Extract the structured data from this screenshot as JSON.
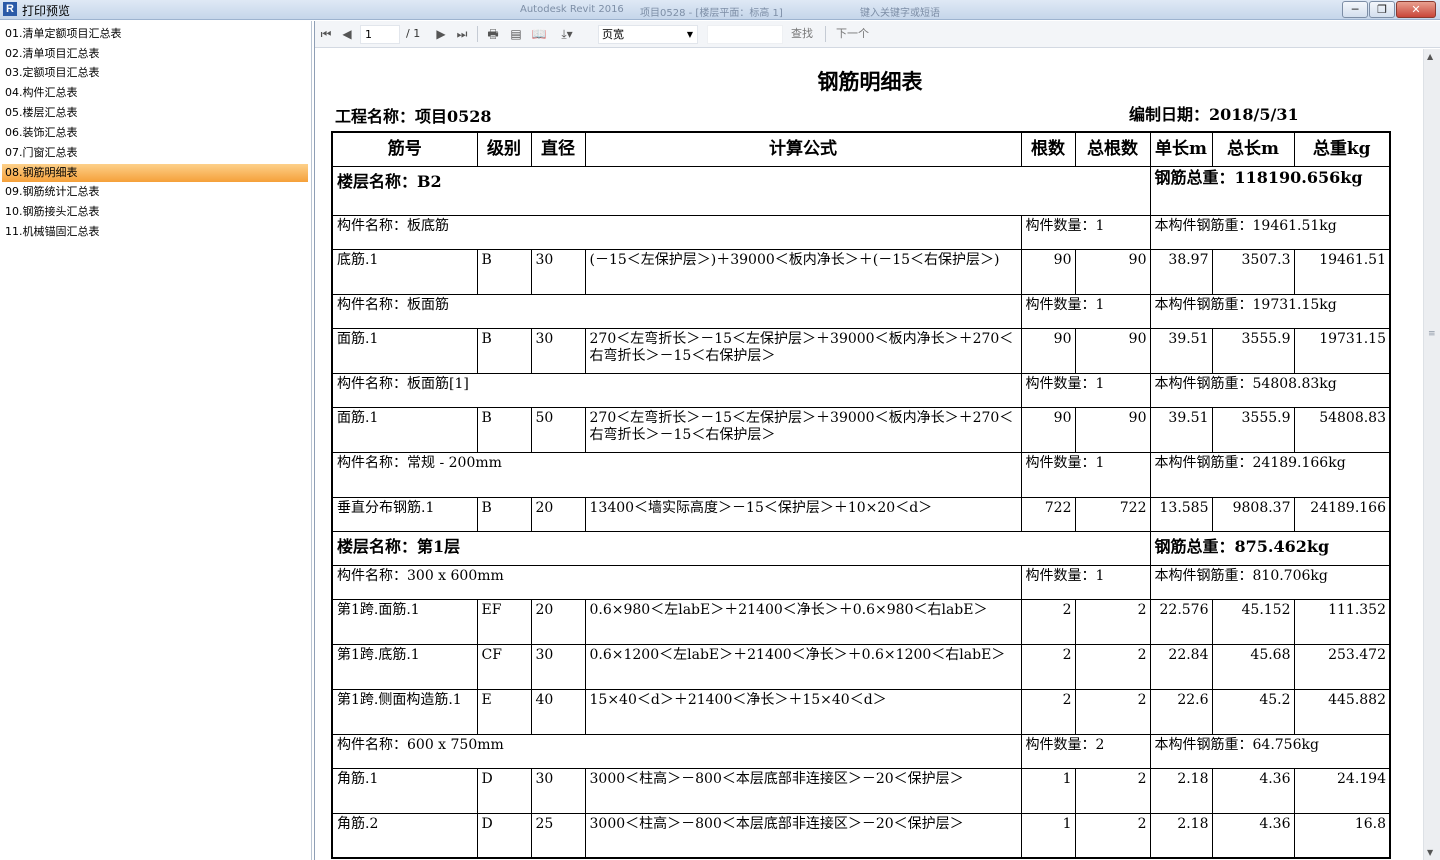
{
  "window": {
    "title": "打印预览",
    "faint_app": "Autodesk Revit 2016",
    "faint_doc": "项目0528 - [楼层平面：标高 1]",
    "faint_search": "键入关键字或短语",
    "buttons": {
      "minimize": "─",
      "restore": "❐",
      "close": "✕"
    }
  },
  "sidebar": {
    "items": [
      {
        "label": "01.清单定额项目汇总表"
      },
      {
        "label": "02.清单项目汇总表"
      },
      {
        "label": "03.定额项目汇总表"
      },
      {
        "label": "04.构件汇总表"
      },
      {
        "label": "05.楼层汇总表"
      },
      {
        "label": "06.装饰汇总表"
      },
      {
        "label": "07.门窗汇总表"
      },
      {
        "label": "08.钢筋明细表"
      },
      {
        "label": "09.钢筋统计汇总表"
      },
      {
        "label": "10.钢筋接头汇总表"
      },
      {
        "label": "11.机械锚固汇总表"
      }
    ],
    "active_index": 7
  },
  "toolbar": {
    "page_current": "1",
    "page_total": "/ 1",
    "zoom_value": "页宽",
    "find_label": "查找",
    "next_label": "下一个",
    "icons": [
      "first-page-icon",
      "prev-page-icon",
      "next-page-icon",
      "last-page-icon",
      "print-icon",
      "page-setup-icon",
      "book-icon",
      "export-icon"
    ]
  },
  "report": {
    "title": "钢筋明细表",
    "project": "工程名称：项目0528",
    "date": "编制日期：2018/5/31",
    "headers": [
      "筋号",
      "级别",
      "直径",
      "计算公式",
      "根数",
      "总根数",
      "单长m",
      "总长m",
      "总重kg"
    ],
    "rows": [
      {
        "kind": "floor",
        "name": "楼层名称：B2",
        "weight": "钢筋总重：118190.656kg"
      },
      {
        "kind": "comp",
        "name": "构件名称：板底筋",
        "count": "构件数量：1",
        "weight": "本构件钢筋重：19461.51kg"
      },
      {
        "kind": "bar",
        "cells": [
          "底筋.1",
          "B",
          "30",
          "(－15＜左保护层＞)＋39000＜板内净长＞＋(－15＜右保护层＞)",
          "90",
          "90",
          "38.97",
          "3507.3",
          "19461.51"
        ]
      },
      {
        "kind": "comp",
        "name": "构件名称：板面筋",
        "count": "构件数量：1",
        "weight": "本构件钢筋重：19731.15kg"
      },
      {
        "kind": "bar",
        "cells": [
          "面筋.1",
          "B",
          "30",
          "270＜左弯折长＞－15＜左保护层＞＋39000＜板内净长＞＋270＜右弯折长＞－15＜右保护层＞",
          "90",
          "90",
          "39.51",
          "3555.9",
          "19731.15"
        ]
      },
      {
        "kind": "comp",
        "name": "构件名称：板面筋[1]",
        "count": "构件数量：1",
        "weight": "本构件钢筋重：54808.83kg"
      },
      {
        "kind": "bar",
        "cells": [
          "面筋.1",
          "B",
          "50",
          "270＜左弯折长＞－15＜左保护层＞＋39000＜板内净长＞＋270＜右弯折长＞－15＜右保护层＞",
          "90",
          "90",
          "39.51",
          "3555.9",
          "54808.83"
        ]
      },
      {
        "kind": "comp",
        "name": "构件名称：常规 - 200mm",
        "count": "构件数量：1",
        "weight": "本构件钢筋重：24189.166kg"
      },
      {
        "kind": "bar",
        "cells": [
          "垂直分布钢筋.1",
          "B",
          "20",
          "13400＜墙实际高度＞－15＜保护层＞＋10×20＜d＞",
          "722",
          "722",
          "13.585",
          "9808.37",
          "24189.166"
        ]
      },
      {
        "kind": "floor",
        "name": "楼层名称：第1层",
        "weight": "钢筋总重：875.462kg"
      },
      {
        "kind": "comp",
        "name": "构件名称：300 x 600mm",
        "count": "构件数量：1",
        "weight": "本构件钢筋重：810.706kg"
      },
      {
        "kind": "bar",
        "cells": [
          "第1跨.面筋.1",
          "EF",
          "20",
          "0.6×980＜左labE＞＋21400＜净长＞＋0.6×980＜右labE＞",
          "2",
          "2",
          "22.576",
          "45.152",
          "111.352"
        ]
      },
      {
        "kind": "bar",
        "cells": [
          "第1跨.底筋.1",
          "CF",
          "30",
          "0.6×1200＜左labE＞＋21400＜净长＞＋0.6×1200＜右labE＞",
          "2",
          "2",
          "22.84",
          "45.68",
          "253.472"
        ]
      },
      {
        "kind": "bar",
        "cells": [
          "第1跨.侧面构造筋.1",
          "E",
          "40",
          "15×40＜d＞＋21400＜净长＞＋15×40＜d＞",
          "2",
          "2",
          "22.6",
          "45.2",
          "445.882"
        ]
      },
      {
        "kind": "comp",
        "name": "构件名称：600 x 750mm",
        "count": "构件数量：2",
        "weight": "本构件钢筋重：64.756kg"
      },
      {
        "kind": "bar",
        "cells": [
          "角筋.1",
          "D",
          "30",
          "3000＜柱高＞－800＜本层底部非连接区＞－20＜保护层＞",
          "1",
          "2",
          "2.18",
          "4.36",
          "24.194"
        ]
      },
      {
        "kind": "bar",
        "cells": [
          "角筋.2",
          "D",
          "25",
          "3000＜柱高＞－800＜本层底部非连接区＞－20＜保护层＞",
          "1",
          "2",
          "2.18",
          "4.36",
          "16.8"
        ]
      }
    ]
  }
}
